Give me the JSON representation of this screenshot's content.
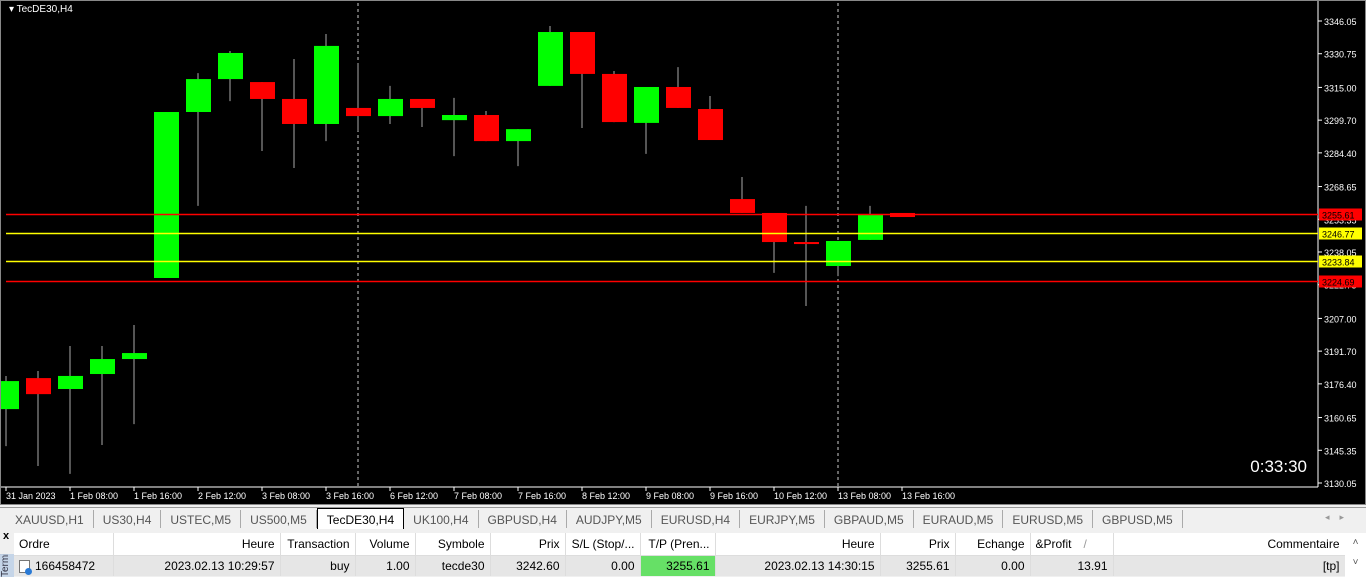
{
  "chart": {
    "title": "TecDE30,H4",
    "timer": "0:33:30",
    "colors": {
      "bull": "#00ff00",
      "bear": "#ff0000",
      "level_red": "#ff0000",
      "level_yellow": "#ffff00"
    },
    "price_axis": [
      "3346.05",
      "3330.75",
      "3315.00",
      "3299.70",
      "3284.40",
      "3268.65",
      "3253.35",
      "3238.05",
      "3222.75",
      "3207.00",
      "3191.70",
      "3176.40",
      "3160.65",
      "3145.35",
      "3130.05"
    ],
    "time_axis": [
      "31 Jan 2023",
      "1 Feb 08:00",
      "1 Feb 16:00",
      "2 Feb 12:00",
      "3 Feb 08:00",
      "3 Feb 16:00",
      "6 Feb 12:00",
      "7 Feb 08:00",
      "7 Feb 16:00",
      "8 Feb 12:00",
      "9 Feb 08:00",
      "9 Feb 16:00",
      "10 Feb 12:00",
      "13 Feb 08:00",
      "13 Feb 16:00"
    ],
    "levels": [
      {
        "price": 3255.61,
        "label": "3255.61",
        "color": "red"
      },
      {
        "price": 3246.77,
        "label": "3246.77",
        "color": "yellow"
      },
      {
        "price": 3233.84,
        "label": "3233.84",
        "color": "yellow"
      },
      {
        "price": 3224.69,
        "label": "3224.69",
        "color": "red"
      }
    ],
    "separators": [
      11,
      26
    ],
    "ohlc": [
      [
        3164.6,
        3180.1,
        3147.3,
        3177.7
      ],
      [
        3179.1,
        3182.4,
        3138.0,
        3171.6
      ],
      [
        3174.0,
        3194.1,
        3134.3,
        3180.1
      ],
      [
        3181.0,
        3194.1,
        3147.8,
        3188.0
      ],
      [
        3188.0,
        3203.9,
        3157.6,
        3190.8
      ],
      [
        3225.9,
        3303.5,
        3225.9,
        3303.5
      ],
      [
        3303.5,
        3321.7,
        3259.6,
        3318.9
      ],
      [
        3318.9,
        3332.0,
        3308.6,
        3331.1
      ],
      [
        3317.5,
        3317.5,
        3285.3,
        3309.6
      ],
      [
        3309.6,
        3328.3,
        3277.3,
        3297.9
      ],
      [
        3297.9,
        3340.0,
        3289.9,
        3334.4
      ],
      [
        3305.4,
        3326.4,
        3294.6,
        3301.6
      ],
      [
        3301.6,
        3315.7,
        3297.9,
        3309.6
      ],
      [
        3309.6,
        3309.6,
        3296.5,
        3305.4
      ],
      [
        3299.7,
        3310.1,
        3282.9,
        3302.1
      ],
      [
        3302.1,
        3304.0,
        3289.9,
        3289.9
      ],
      [
        3289.9,
        3295.5,
        3278.2,
        3295.5
      ],
      [
        3315.7,
        3343.7,
        3315.7,
        3340.9
      ],
      [
        3340.9,
        3340.9,
        3296.0,
        3321.3
      ],
      [
        3321.3,
        3322.7,
        3298.8,
        3298.8
      ],
      [
        3298.4,
        3315.2,
        3283.9,
        3315.2
      ],
      [
        3315.2,
        3324.5,
        3305.4,
        3305.4
      ],
      [
        3304.9,
        3311.0,
        3290.4,
        3290.4
      ],
      [
        3262.8,
        3273.1,
        3256.3,
        3256.3
      ],
      [
        3256.3,
        3256.3,
        3228.3,
        3242.7
      ],
      [
        3242.7,
        3259.6,
        3212.8,
        3241.8
      ],
      [
        3231.5,
        3243.2,
        3226.8,
        3243.2
      ],
      [
        3243.7,
        3259.6,
        3243.7,
        3255.8
      ],
      [
        3256.3,
        3256.3,
        3254.4,
        3254.4
      ]
    ]
  },
  "tabs": [
    "XAUUSD,H1",
    "US30,H4",
    "USTEC,M5",
    "US500,M5",
    "TecDE30,H4",
    "UK100,H4",
    "GBPUSD,H4",
    "AUDJPY,M5",
    "EURUSD,H4",
    "EURJPY,M5",
    "GBPAUD,M5",
    "EURAUD,M5",
    "EURUSD,M5",
    "GBPUSD,M5"
  ],
  "active_tab": 4,
  "terminal": {
    "close": "x",
    "label": "Terminal",
    "columns": [
      "Ordre",
      "Heure",
      "Transaction",
      "Volume",
      "Symbole",
      "Prix",
      "S/L (Stop/...",
      "T/P (Pren...",
      "Heure",
      "Prix",
      "Echange",
      "&Profit",
      "Commentaire"
    ],
    "sort_indicator": "/",
    "rows": [
      [
        "166458472",
        "2023.02.13 10:29:57",
        "buy",
        "1.00",
        "tecde30",
        "3242.60",
        "0.00",
        "3255.61",
        "2023.02.13 14:30:15",
        "3255.61",
        "0.00",
        "13.91",
        "[tp]"
      ]
    ]
  }
}
